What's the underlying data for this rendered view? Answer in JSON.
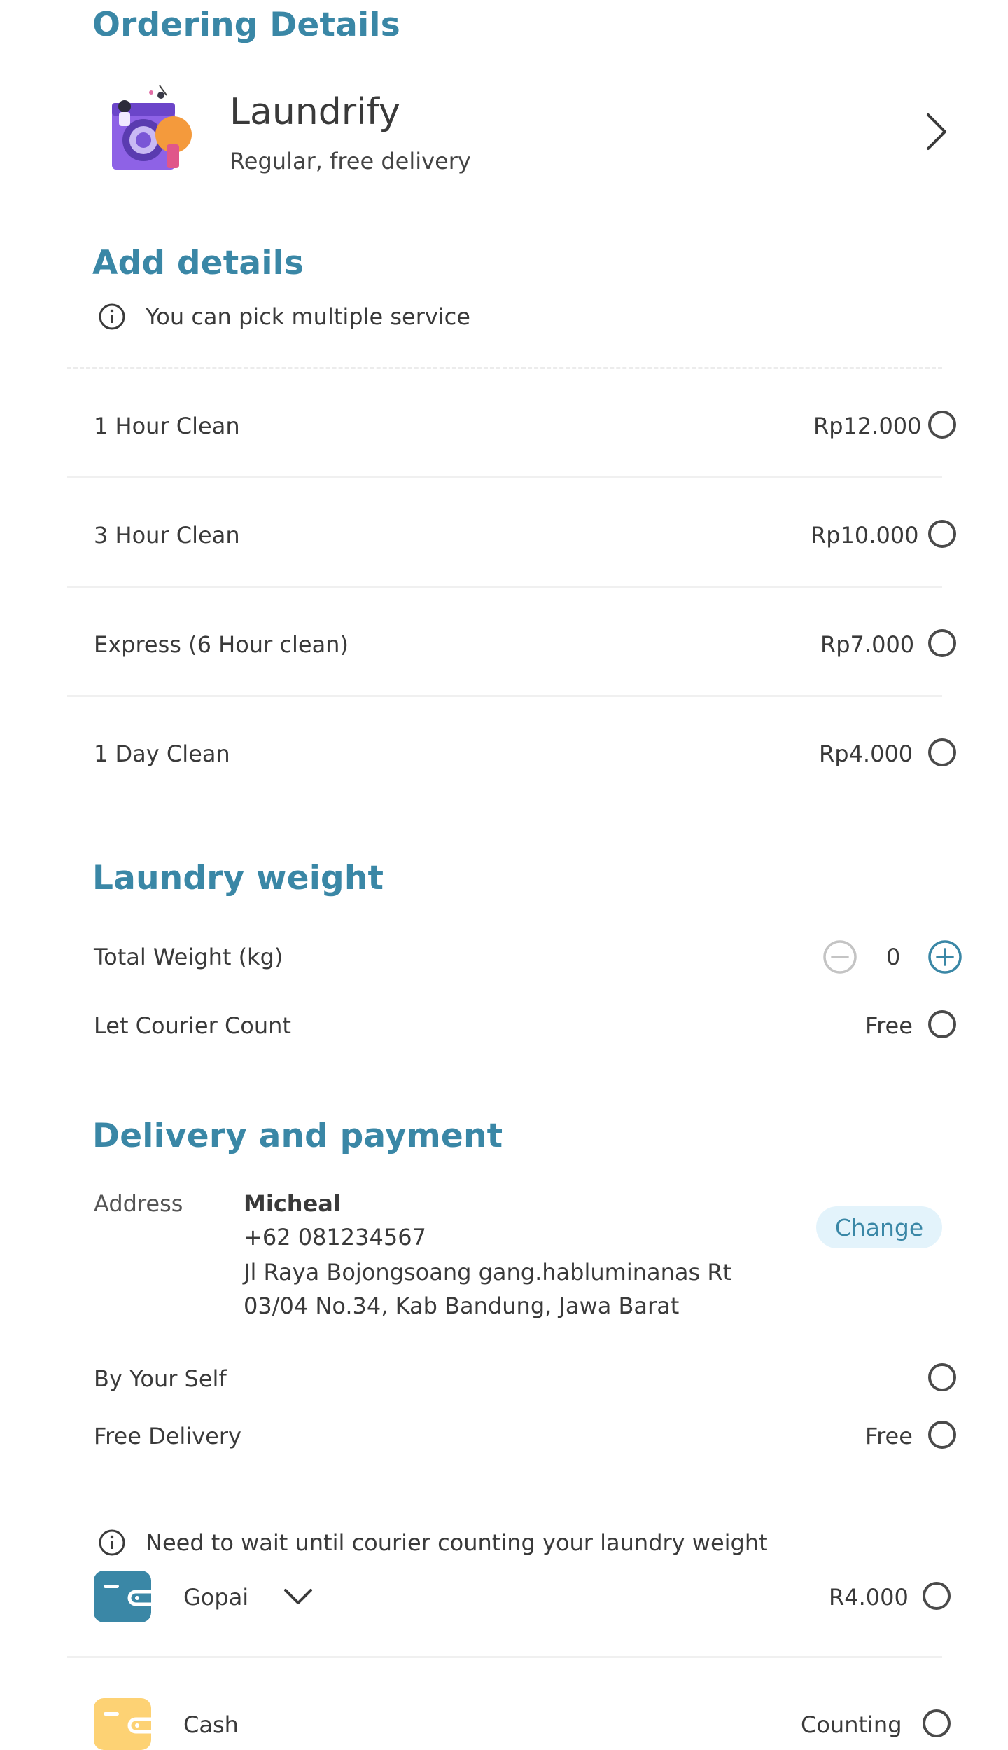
{
  "ordering": {
    "title": "Ordering Details",
    "store_name": "Laundrify",
    "store_subtitle": "Regular, free delivery"
  },
  "details": {
    "title": "Add details",
    "info": "You can pick multiple service",
    "services": [
      {
        "name": "1 Hour Clean",
        "price": "Rp12.000"
      },
      {
        "name": "3 Hour Clean",
        "price": "Rp10.000"
      },
      {
        "name": "Express (6 Hour clean)",
        "price": "Rp7.000"
      },
      {
        "name": "1 Day Clean",
        "price": "Rp4.000"
      }
    ]
  },
  "weight": {
    "title": "Laundry weight",
    "total_label": "Total Weight (kg)",
    "total_value": "0",
    "courier_label": "Let Courier Count",
    "courier_value": "Free"
  },
  "delivery": {
    "title": "Delivery and payment",
    "address_label": "Address",
    "name": "Micheal",
    "phone": "+62 081234567",
    "address_line1": "Jl Raya Bojongsoang gang.habluminanas Rt",
    "address_line2": "03/04 No.34, Kab Bandung, Jawa Barat",
    "change_label": "Change",
    "by_self_label": "By Your Self",
    "free_delivery_label": "Free Delivery",
    "free_delivery_value": "Free",
    "info": "Need to wait until courier counting your laundry weight"
  },
  "payment": [
    {
      "method": "Gopai",
      "amount": "R4.000",
      "icon_color": "#3a87a6"
    },
    {
      "method": "Cash",
      "amount": "Counting",
      "icon_color": "#fdd274"
    }
  ],
  "colors": {
    "accent": "#3a87a6",
    "text": "#3a3a3a"
  }
}
